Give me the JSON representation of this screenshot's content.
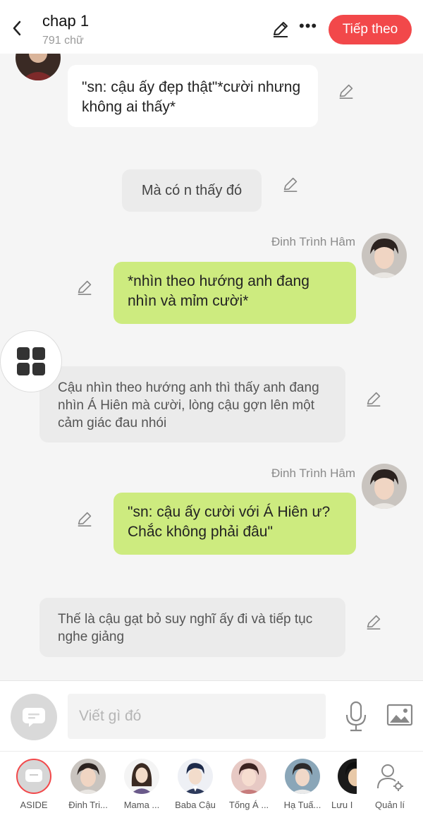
{
  "header": {
    "title": "chap 1",
    "subtitle": "791 chữ",
    "next_label": "Tiếp theo"
  },
  "messages": [
    {
      "type": "left",
      "text": "\"sn: cậu ấy đẹp thật\"*cười nhưng không ai thấy*"
    },
    {
      "type": "center",
      "text": "Mà có n thấy đó"
    },
    {
      "type": "right",
      "name": "Đinh Trình Hâm",
      "text": "*nhìn theo hướng anh đang nhìn và mỉm cười*"
    },
    {
      "type": "narration",
      "text": "Cậu nhìn theo hướng anh thì thấy anh đang nhìn Á Hiên mà cười, lòng cậu gợn lên một cảm giác đau nhói"
    },
    {
      "type": "right",
      "name": "Đinh Trình Hâm",
      "text": "\"sn: cậu ấy cười với Á Hiên ư? Chắc không phải đâu\""
    },
    {
      "type": "narration",
      "text": "Thế là cậu gạt bỏ suy nghĩ ấy đi và tiếp tục nghe giảng"
    }
  ],
  "input": {
    "placeholder": "Viết gì đó"
  },
  "characters": [
    {
      "label": "ASIDE"
    },
    {
      "label": "Đinh Tri..."
    },
    {
      "label": "Mama ..."
    },
    {
      "label": "Baba Cậu"
    },
    {
      "label": "Tống Á ..."
    },
    {
      "label": "Hạ Tuấ..."
    },
    {
      "label": "Lưu I"
    },
    {
      "label": "Quản lí"
    }
  ],
  "colors": {
    "accent": "#f2484a",
    "bubble_green": "#cdeb7f",
    "bubble_grey": "#ebebeb"
  },
  "icons": [
    "back-arrow-icon",
    "pencil-icon",
    "more-icon",
    "grid-menu-icon",
    "aside-chat-icon",
    "mic-icon",
    "image-icon",
    "user-settings-icon"
  ]
}
